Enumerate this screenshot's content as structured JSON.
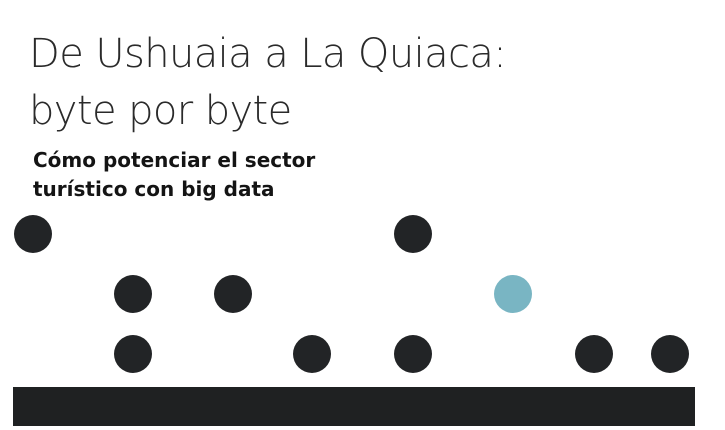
{
  "title": {
    "line1": "De Ushuaia a La Quiaca:",
    "line2": "byte por byte"
  },
  "subtitle": {
    "line1": "Cómo potenciar el sector",
    "line2": "turístico con big data"
  },
  "colors": {
    "text": "#222222",
    "dot_dark": "#222426",
    "dot_accent": "#79b5c3",
    "bar": "#1f2122"
  }
}
